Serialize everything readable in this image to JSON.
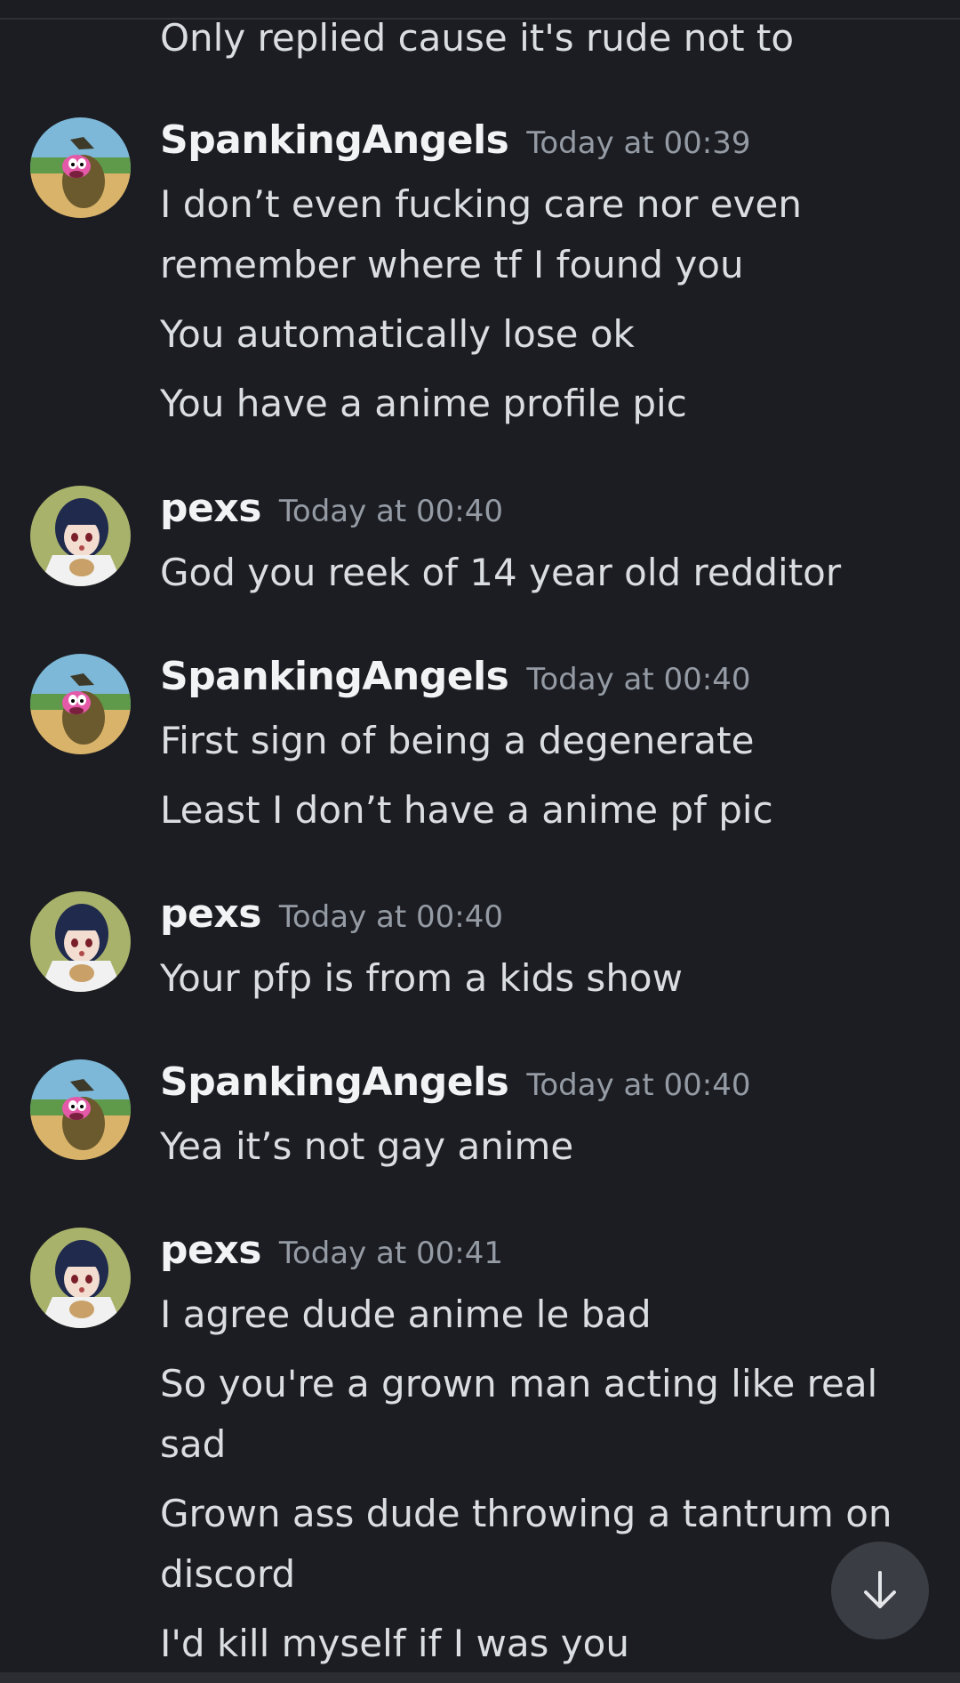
{
  "continuation": "Only replied cause it's rude not to",
  "groups": [
    {
      "username": "SpankingAngels",
      "timestamp": "Today at 00:39",
      "messages": [
        "I don’t even fucking care nor even remember where tf I found you",
        "You automatically lose ok",
        "You have a anime profile pic"
      ]
    },
    {
      "username": "pexs",
      "timestamp": "Today at 00:40",
      "messages": [
        "God you reek of 14 year old redditor"
      ]
    },
    {
      "username": "SpankingAngels",
      "timestamp": "Today at 00:40",
      "messages": [
        "First sign of being a degenerate",
        "Least I don’t have a anime pf pic"
      ]
    },
    {
      "username": "pexs",
      "timestamp": "Today at 00:40",
      "messages": [
        "Your pfp is from a kids show"
      ]
    },
    {
      "username": "SpankingAngels",
      "timestamp": "Today at 00:40",
      "messages": [
        "Yea it’s not gay anime"
      ]
    },
    {
      "username": "pexs",
      "timestamp": "Today at 00:41",
      "messages": [
        "I agree dude anime le bad",
        "So you're a grown man acting like real sad",
        "Grown ass dude throwing a tantrum on discord",
        "I'd kill myself if I was you"
      ]
    }
  ],
  "scroll_button": {
    "icon": "arrow-down-icon"
  },
  "colors": {
    "background": "#1c1d22",
    "username": "#f2f3f5",
    "message": "#dbdee1",
    "timestamp": "#949ba4",
    "scroll_button": "#3a3d44"
  }
}
